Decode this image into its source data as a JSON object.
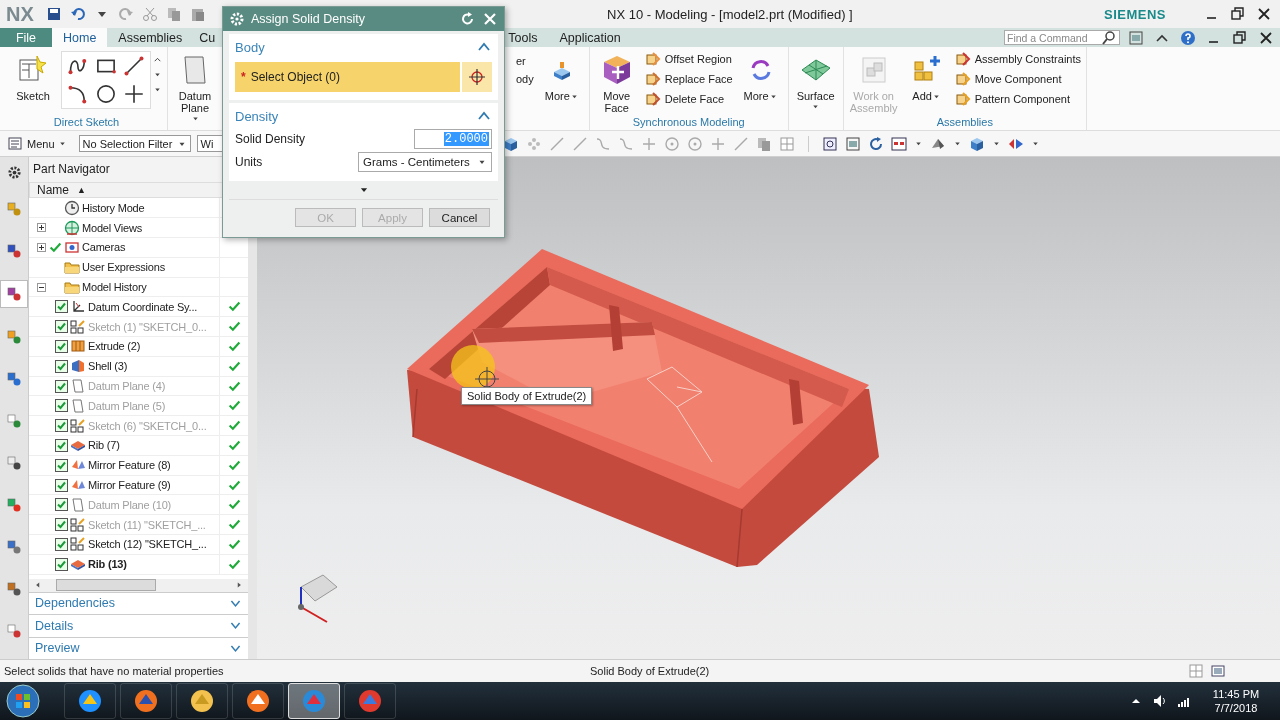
{
  "title_bar": {
    "logo": "NX",
    "title": "NX 10 - Modeling - [model2.prt (Modified) ]",
    "brand": "SIEMENS"
  },
  "tabs": [
    {
      "label": "File",
      "kind": "file",
      "selected": false
    },
    {
      "label": "Home",
      "kind": "tab",
      "selected": true
    },
    {
      "label": "Assemblies",
      "kind": "tab",
      "selected": false
    },
    {
      "label": "Cu",
      "kind": "tab",
      "selected": false
    },
    {
      "label": "Tools",
      "kind": "tab",
      "selected": false
    },
    {
      "label": "Application",
      "kind": "tab",
      "selected": false
    }
  ],
  "find_command": {
    "placeholder": "Find a Command"
  },
  "ribbon_left": [
    {
      "label": "Direct Sketch",
      "items": [
        {
          "kind": "big",
          "label": "Sketch",
          "dropdown": false
        },
        {
          "kind": "sketch-tools"
        }
      ]
    },
    {
      "items": [
        {
          "kind": "big",
          "label": "Datum Plane",
          "dropdown": true
        }
      ]
    }
  ],
  "ribbon_right": [
    {
      "items": [
        {
          "kind": "fragment",
          "lines": [
            "er",
            "ody"
          ]
        },
        {
          "kind": "big",
          "label": "More",
          "dropdown": true
        }
      ]
    },
    {
      "label": "Synchronous Modeling",
      "items": [
        {
          "kind": "big",
          "label": "Move Face",
          "dropdown": false
        },
        {
          "kind": "small-list",
          "entries": [
            "Offset Region",
            "Replace Face",
            "Delete Face"
          ]
        },
        {
          "kind": "big",
          "label": "More",
          "dropdown": true
        }
      ]
    },
    {
      "items": [
        {
          "kind": "big",
          "label": "Surface",
          "dropdown": true
        }
      ]
    },
    {
      "label": "Assemblies",
      "items": [
        {
          "kind": "big",
          "label": "Work on Assembly",
          "dropdown": false,
          "disabled": true
        },
        {
          "kind": "big",
          "label": "Add",
          "dropdown": true
        },
        {
          "kind": "small-list",
          "entries": [
            "Assembly Constraints",
            "Move Component",
            "Pattern Component"
          ]
        }
      ]
    }
  ],
  "toolbar": {
    "menu": "Menu",
    "filter": "No Selection Filter",
    "scope": "Wi"
  },
  "side_tabs": [
    {
      "selected": false
    },
    {
      "selected": false
    },
    {
      "selected": true
    },
    {
      "selected": false
    },
    {
      "selected": false
    },
    {
      "selected": false
    },
    {
      "selected": false
    },
    {
      "selected": false
    },
    {
      "selected": false
    },
    {
      "selected": false
    },
    {
      "selected": false
    }
  ],
  "navigator": {
    "title": "Part Navigator",
    "column": "Name",
    "sort_mark": "▲",
    "tree": [
      {
        "label": "History Mode",
        "kind": "clock"
      },
      {
        "label": "Model Views",
        "kind": "views",
        "expanded": false
      },
      {
        "label": "Cameras",
        "kind": "camera",
        "expanded": false,
        "shown": true
      },
      {
        "label": "User Expressions",
        "kind": "folder"
      },
      {
        "label": "Model History",
        "kind": "folder",
        "expanded": true,
        "children": [
          {
            "label": "Datum Coordinate Sy...",
            "kind": "csys",
            "checked": true,
            "dimmed": false,
            "current": false,
            "status_ok": true
          },
          {
            "label": "Sketch (1) \"SKETCH_0...",
            "kind": "sketch",
            "checked": true,
            "dimmed": true,
            "current": false,
            "status_ok": true
          },
          {
            "label": "Extrude (2)",
            "kind": "extrude",
            "checked": true,
            "dimmed": false,
            "current": false,
            "status_ok": true
          },
          {
            "label": "Shell (3)",
            "kind": "shell",
            "checked": true,
            "dimmed": false,
            "current": false,
            "status_ok": true
          },
          {
            "label": "Datum Plane (4)",
            "kind": "plane",
            "checked": true,
            "dimmed": true,
            "current": false,
            "status_ok": true
          },
          {
            "label": "Datum Plane (5)",
            "kind": "plane",
            "checked": true,
            "dimmed": true,
            "current": false,
            "status_ok": true
          },
          {
            "label": "Sketch (6) \"SKETCH_0...",
            "kind": "sketch",
            "checked": true,
            "dimmed": true,
            "current": false,
            "status_ok": true
          },
          {
            "label": "Rib (7)",
            "kind": "rib",
            "checked": true,
            "dimmed": false,
            "current": false,
            "status_ok": true
          },
          {
            "label": "Mirror Feature (8)",
            "kind": "mirror",
            "checked": true,
            "dimmed": false,
            "current": false,
            "status_ok": true
          },
          {
            "label": "Mirror Feature (9)",
            "kind": "mirror",
            "checked": true,
            "dimmed": false,
            "current": false,
            "status_ok": true
          },
          {
            "label": "Datum Plane (10)",
            "kind": "plane",
            "checked": true,
            "dimmed": true,
            "current": false,
            "status_ok": true
          },
          {
            "label": "Sketch (11) \"SKETCH_...",
            "kind": "sketch",
            "checked": true,
            "dimmed": true,
            "current": false,
            "status_ok": true
          },
          {
            "label": "Sketch (12) \"SKETCH_...",
            "kind": "sketch",
            "checked": true,
            "dimmed": false,
            "current": false,
            "status_ok": true
          },
          {
            "label": "Rib (13)",
            "kind": "rib",
            "checked": true,
            "dimmed": false,
            "current": true,
            "status_ok": true
          }
        ]
      }
    ],
    "panels": [
      {
        "label": "Dependencies",
        "expanded": false
      },
      {
        "label": "Details",
        "expanded": false
      },
      {
        "label": "Preview",
        "expanded": false
      }
    ]
  },
  "viewport": {
    "tooltip": "Solid Body of Extrude(2)"
  },
  "dialog": {
    "title": "Assign Solid Density",
    "sections": [
      {
        "title": "Body",
        "expanded": true
      },
      {
        "title": "Density",
        "expanded": true
      }
    ],
    "select": {
      "mark": "*",
      "label": "Select Object (0)"
    },
    "density": {
      "label": "Solid Density",
      "value": "2.0000"
    },
    "units": {
      "label": "Units",
      "value": "Grams - Centimeters"
    },
    "buttons": [
      {
        "label": "OK",
        "disabled": true
      },
      {
        "label": "Apply",
        "disabled": true
      },
      {
        "label": "Cancel",
        "disabled": false
      }
    ]
  },
  "status_bar": {
    "prompt": "Select solids that have no material properties",
    "selection": "Solid Body of Extrude(2)"
  },
  "taskbar": {
    "apps": [
      {
        "selected": false
      },
      {
        "selected": false
      },
      {
        "selected": false
      },
      {
        "selected": false
      },
      {
        "selected": true
      },
      {
        "selected": false
      }
    ],
    "time": "11:45 PM",
    "date": "7/7/2018"
  }
}
